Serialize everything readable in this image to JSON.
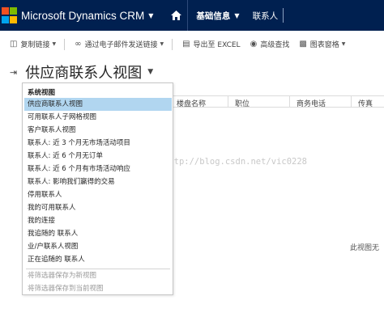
{
  "nav": {
    "app_title": "Microsoft Dynamics CRM",
    "area": "基础信息",
    "entity": "联系人",
    "colors": {
      "bar": "#002050",
      "logo": [
        "#f25022",
        "#7fba00",
        "#00a4ef",
        "#ffb900"
      ]
    }
  },
  "commands": [
    {
      "label": "复制链接",
      "icon": "link-icon",
      "has_dropdown": true
    },
    {
      "label": "通过电子邮件发送链接",
      "icon": "email-link-icon",
      "has_dropdown": true
    },
    {
      "label": "导出至 EXCEL",
      "icon": "excel-icon",
      "has_dropdown": false
    },
    {
      "label": "高级查找",
      "icon": "advanced-find-icon",
      "has_dropdown": false
    },
    {
      "label": "图表窗格",
      "icon": "chart-pane-icon",
      "has_dropdown": true
    }
  ],
  "view": {
    "title": "供应商联系人视图"
  },
  "grid": {
    "columns": [
      "楼盘名称",
      "职位",
      "商务电话",
      "传真"
    ],
    "watermark": "http://blog.csdn.net/vic0228",
    "empty_message": "此视图无"
  },
  "menu": {
    "header": "系统视图",
    "items": [
      {
        "label": "供应商联系人视图",
        "selected": true
      },
      {
        "label": "可用联系人子网格视图",
        "selected": false
      },
      {
        "label": "客户联系人视图",
        "selected": false
      },
      {
        "label": "联系人: 近 3 个月无市场活动项目",
        "selected": false
      },
      {
        "label": "联系人: 近 6 个月无订单",
        "selected": false
      },
      {
        "label": "联系人: 近 6 个月有市场活动响应",
        "selected": false
      },
      {
        "label": "联系人: 影响我们赢得的交易",
        "selected": false
      },
      {
        "label": "停用联系人",
        "selected": false
      },
      {
        "label": "我的可用联系人",
        "selected": false
      },
      {
        "label": "我的连接",
        "selected": false
      },
      {
        "label": "我追随的 联系人",
        "selected": false
      },
      {
        "label": "业/户联系人视图",
        "selected": false
      },
      {
        "label": "正在追随的 联系人",
        "selected": false
      }
    ],
    "actions": [
      {
        "label": "将筛选器保存为新视图"
      },
      {
        "label": "将筛选器保存到当前视图"
      }
    ],
    "colors": {
      "selected": "#b1d6f0"
    }
  }
}
